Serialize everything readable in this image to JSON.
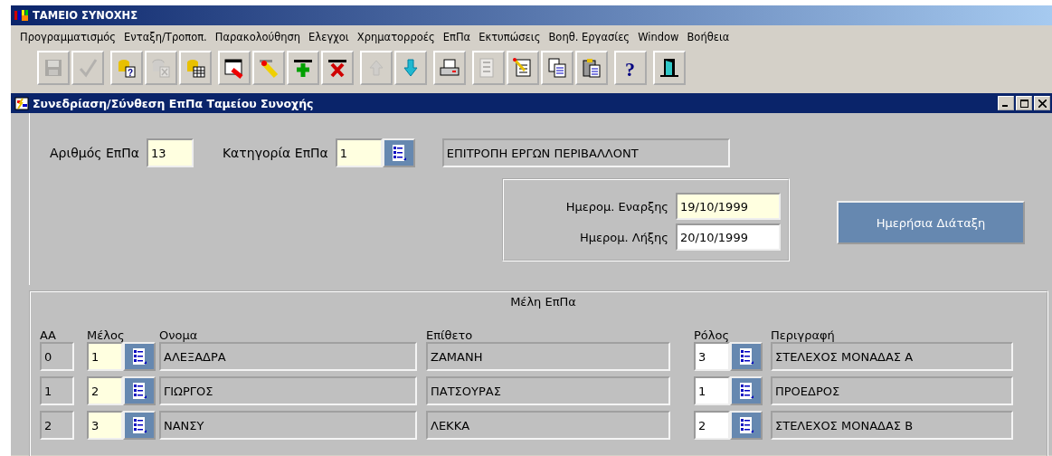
{
  "app_window": {
    "title": "ΤΑΜΕΙΟ ΣΥΝΟΧΗΣ"
  },
  "menu": [
    "Προγραμματισμός",
    "Ενταξη/Τροποπ.",
    "Παρακολούθηση",
    "Ελεγχοι",
    "Χρηματορροές",
    "ΕπΠα",
    "Εκτυπώσεις",
    "Βοηθ. Εργασίες",
    "Window",
    "Βοήθεια"
  ],
  "toolbar": [
    [
      {
        "kind": "save",
        "disabled": true
      },
      {
        "kind": "check",
        "disabled": true
      }
    ],
    [
      {
        "kind": "db-query",
        "disabled": false,
        "glyph": "?"
      },
      {
        "kind": "db-clear",
        "disabled": true
      },
      {
        "kind": "db-table",
        "disabled": false
      }
    ],
    [
      {
        "kind": "window-edit",
        "disabled": false
      },
      {
        "kind": "pencil",
        "disabled": false
      },
      {
        "kind": "add",
        "disabled": false
      },
      {
        "kind": "delete",
        "disabled": false
      }
    ],
    [
      {
        "kind": "up",
        "disabled": true
      },
      {
        "kind": "down",
        "disabled": false
      }
    ],
    [
      {
        "kind": "print",
        "disabled": false
      }
    ],
    [
      {
        "kind": "list",
        "disabled": true
      },
      {
        "kind": "edit-doc",
        "disabled": false
      },
      {
        "kind": "copy",
        "disabled": false
      },
      {
        "kind": "paste",
        "disabled": false
      }
    ],
    [
      {
        "kind": "help",
        "disabled": false,
        "glyph": "?"
      }
    ],
    [
      {
        "kind": "exit",
        "disabled": false
      }
    ]
  ],
  "form_window": {
    "title": "Συνεδρίαση/Σύνθεση ΕπΠα Ταμείου Συνοχής",
    "committee_number": {
      "label": "Αριθμός ΕπΠα",
      "value": "13",
      "required": true
    },
    "category": {
      "label": "Κατηγορία ΕπΠα",
      "value": "1",
      "required": true
    },
    "category_description": "ΕΠΙΤΡΟΠΗ ΕΡΓΩΝ ΠΕΡΙΒΑΛΛΟΝΤ",
    "start_date": {
      "label": "Ημερομ. Εναρξης",
      "value": "19/10/1999",
      "required": true
    },
    "end_date": {
      "label": "Ημερομ. Λήξης",
      "value": "20/10/1999",
      "required": false
    },
    "agenda_button": "Ημερήσια Διάταξη",
    "members": {
      "title": "Μέλη ΕπΠα",
      "columns": [
        "ΑΑ",
        "Μέλος",
        "Ονομα",
        "Επίθετο",
        "Ρόλος",
        "Περιγραφή"
      ],
      "rows": [
        {
          "aa": "0",
          "member": "1",
          "name": "ΑΛΕΞΑΔΡΑ",
          "surname": "ΖΑΜΑΝΗ",
          "role": "3",
          "description": "ΣΤΕΛΕΧΟΣ ΜΟΝΑΔΑΣ Α"
        },
        {
          "aa": "1",
          "member": "2",
          "name": "ΓΙΩΡΓΟΣ",
          "surname": "ΠΑΤΣΟΥΡΑΣ",
          "role": "1",
          "description": "ΠΡΟΕΔΡΟΣ"
        },
        {
          "aa": "2",
          "member": "3",
          "name": "ΝΑΝΣΥ",
          "surname": "ΛΕΚΚΑ",
          "role": "2",
          "description": "ΣΤΕΛΕΧΟΣ ΜΟΝΑΔΑΣ Β"
        }
      ]
    }
  }
}
